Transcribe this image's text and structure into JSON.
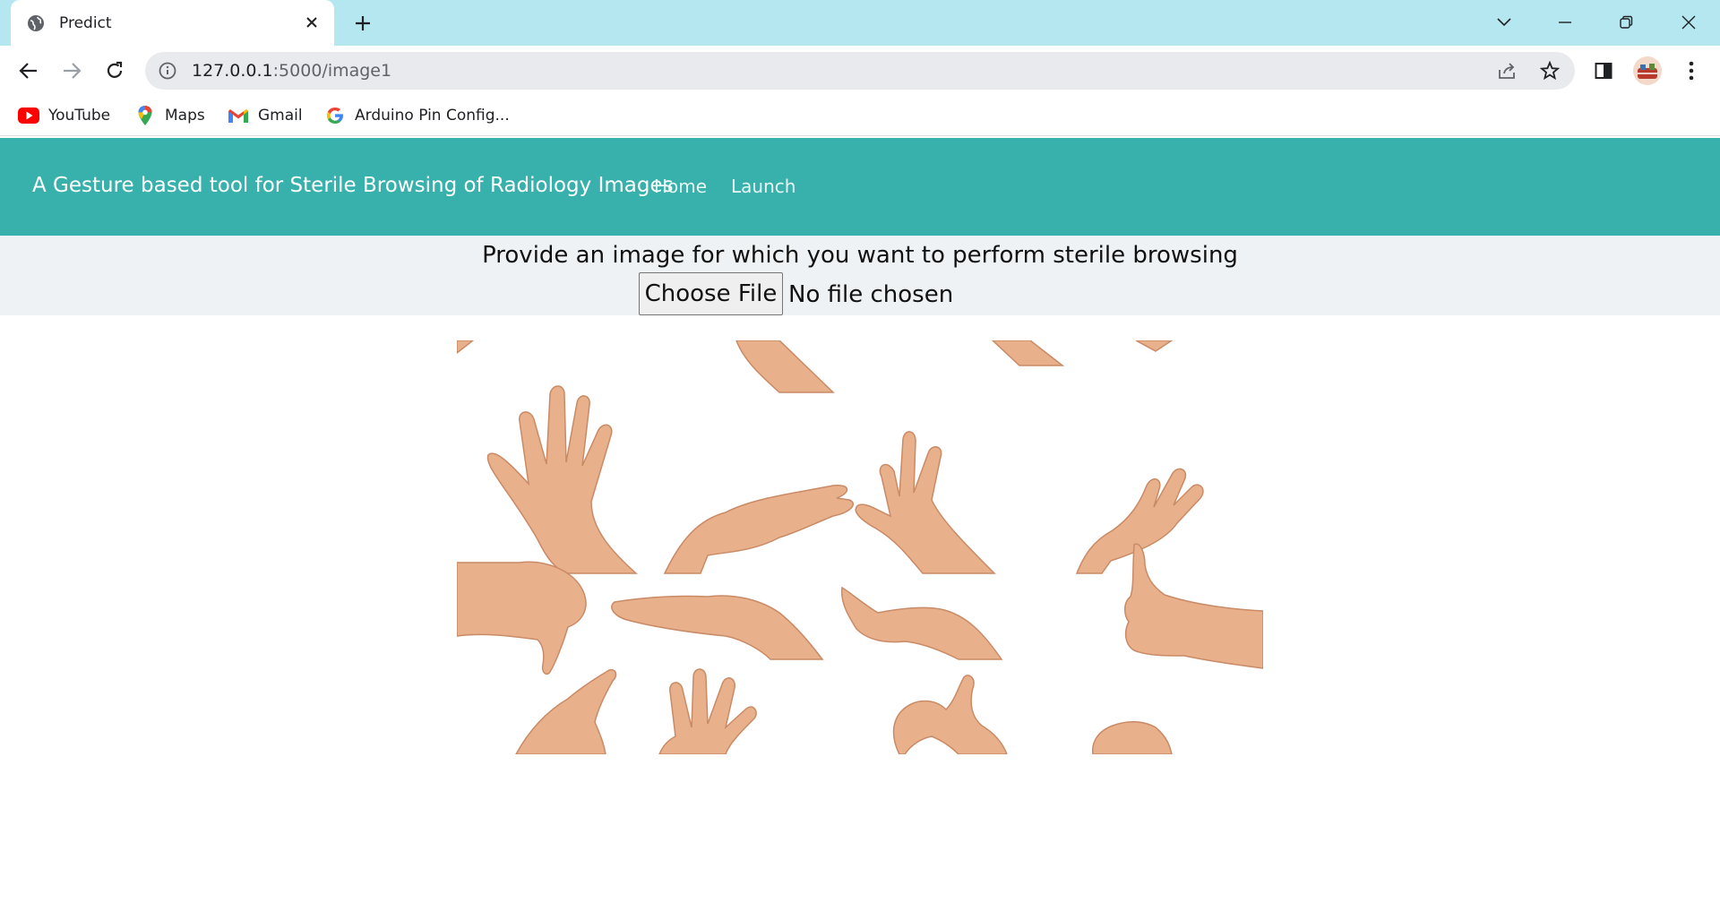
{
  "browser": {
    "tab_title": "Predict",
    "url_host": "127.0.0.1",
    "url_path": ":5000/image1",
    "bookmarks": [
      {
        "label": "YouTube",
        "icon": "youtube-icon"
      },
      {
        "label": "Maps",
        "icon": "maps-pin-icon"
      },
      {
        "label": "Gmail",
        "icon": "gmail-icon"
      },
      {
        "label": "Arduino Pin Config...",
        "icon": "google-icon"
      }
    ],
    "frame_color": "#b5e7f1"
  },
  "navbar": {
    "brand": "A Gesture based tool for Sterile Browsing of Radiology Images",
    "links": [
      "Home",
      "Launch"
    ],
    "color": "#38b0ac"
  },
  "form": {
    "prompt": "Provide an image for which you want to perform sterile browsing",
    "button_label": "Choose File",
    "status": "No file chosen"
  },
  "image": {
    "description_icon": "hand-gestures-image",
    "skin_color": "#e9b08c"
  }
}
